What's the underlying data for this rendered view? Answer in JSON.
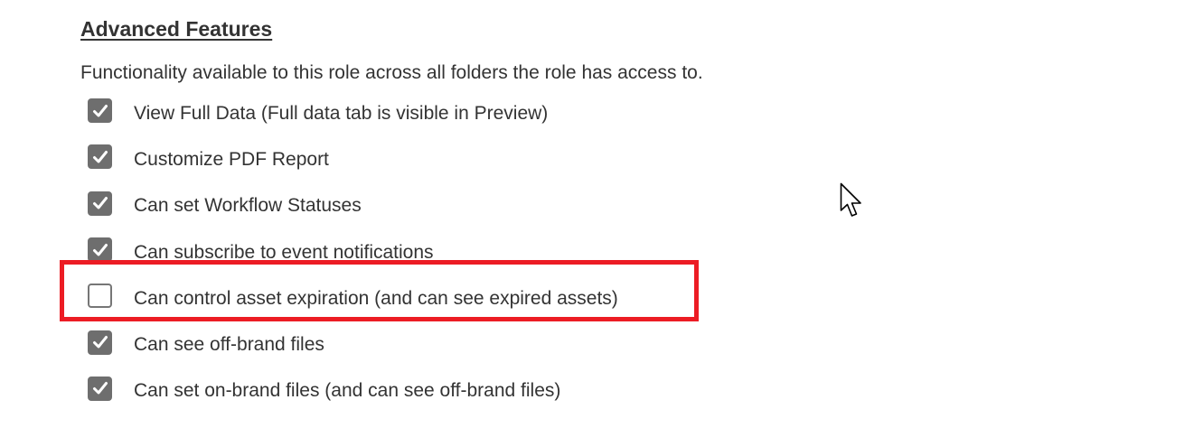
{
  "section": {
    "title": "Advanced Features",
    "description": "Functionality available to this role across all folders the role has access to."
  },
  "features": [
    {
      "label": "View Full Data (Full data tab is visible in Preview)",
      "checked": true
    },
    {
      "label": "Customize PDF Report",
      "checked": true
    },
    {
      "label": "Can set Workflow Statuses",
      "checked": true
    },
    {
      "label": "Can subscribe to event notifications",
      "checked": true
    },
    {
      "label": "Can control asset expiration (and can see expired assets)",
      "checked": false
    },
    {
      "label": "Can see off-brand files",
      "checked": true
    },
    {
      "label": "Can set on-brand files (and can see off-brand files)",
      "checked": true
    }
  ],
  "highlight": {
    "target_feature_index": 4,
    "color": "#ec1c24"
  },
  "icons": {
    "checkbox_checked": "checkmark-icon",
    "cursor": "mouse-pointer-icon"
  },
  "colors": {
    "text": "#333333",
    "checkbox_fill": "#6e6e6e",
    "highlight": "#ec1c24"
  }
}
